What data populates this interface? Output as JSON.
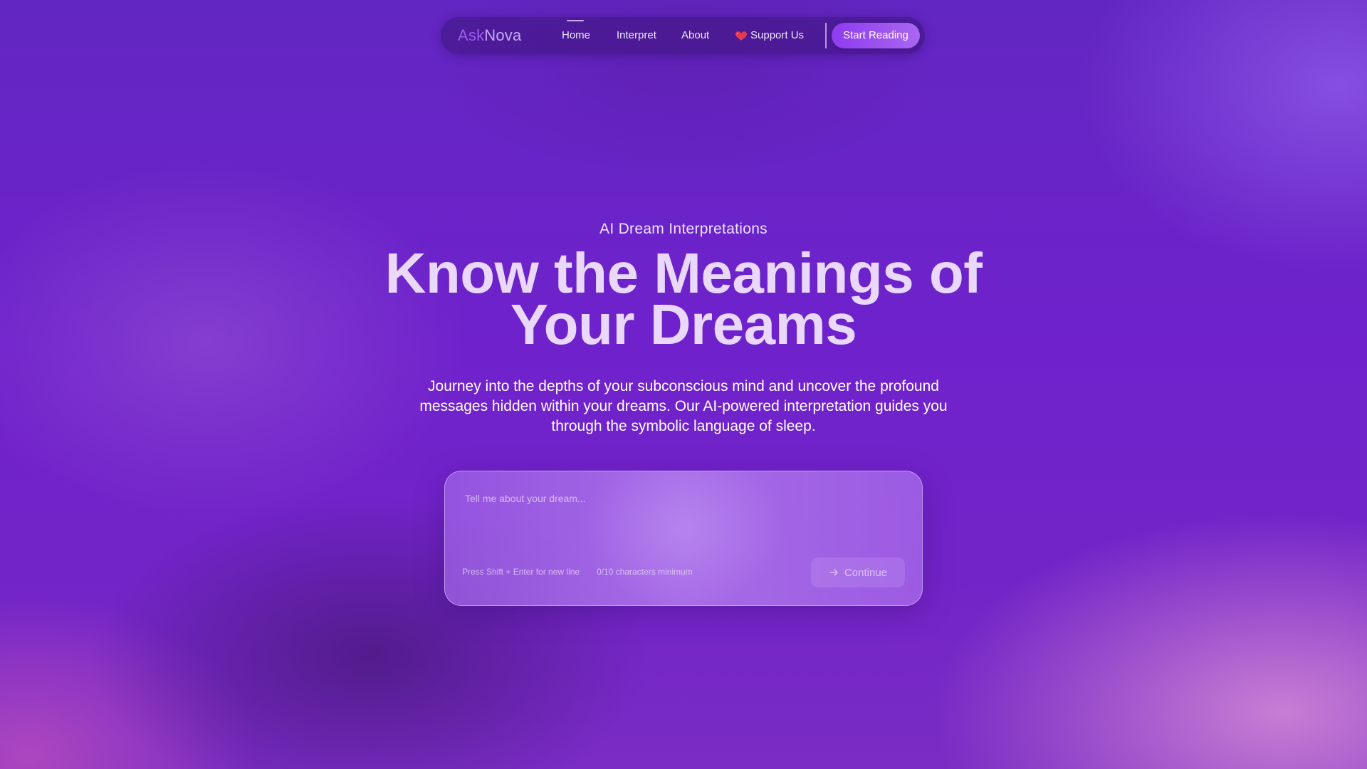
{
  "nav": {
    "logo_part1": "Ask",
    "logo_part2": "Nova",
    "links": [
      {
        "label": "Home",
        "active": true
      },
      {
        "label": "Interpret"
      },
      {
        "label": "About"
      },
      {
        "label": "Support Us",
        "icon": "heart-icon"
      }
    ],
    "cta_label": "Start Reading"
  },
  "hero": {
    "eyebrow": "AI Dream Interpretations",
    "headline_line1": "Know the Meanings of",
    "headline_line2": "Your Dreams",
    "description": "Journey into the depths of your subconscious mind and uncover the profound messages hidden within your dreams. Our AI-powered interpretation guides you through the symbolic language of sleep."
  },
  "dream_input": {
    "value": "",
    "placeholder": "Tell me about your dream...",
    "hint_newline": "Press Shift + Enter for new line",
    "char_count": "0/10 characters minimum",
    "continue_label": "Continue",
    "continue_icon": "arrow-right-icon"
  },
  "colors": {
    "background": "#6b22c6",
    "accent": "#8e3cf0",
    "heading": "#ead8fb",
    "heart": "#e23b4e"
  }
}
